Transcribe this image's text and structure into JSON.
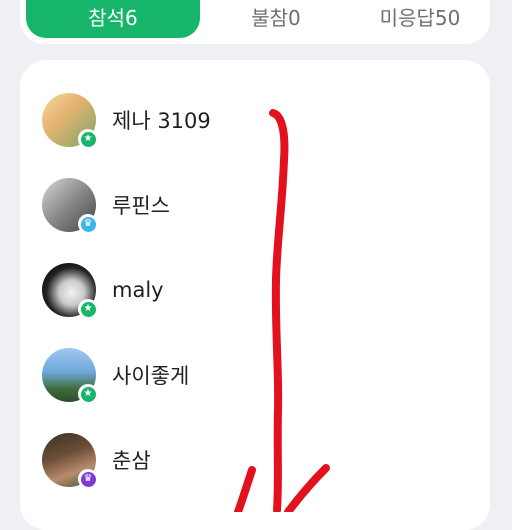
{
  "tabs": [
    {
      "label": "참석6",
      "active": true
    },
    {
      "label": "불참0",
      "active": false
    },
    {
      "label": "미응답50",
      "active": false
    }
  ],
  "members": [
    {
      "name": "제나 3109",
      "badge_icon": "star-icon",
      "badge_color": "#17b56a",
      "avatar": "flower-doll-photo"
    },
    {
      "name": "루핀스",
      "badge_icon": "crown-icon",
      "badge_color": "#3bb6e8",
      "avatar": "street-photo"
    },
    {
      "name": "maly",
      "badge_icon": "star-icon",
      "badge_color": "#17b56a",
      "avatar": "bw-portrait-photo"
    },
    {
      "name": "사이좋게",
      "badge_icon": "star-icon",
      "badge_color": "#17b56a",
      "avatar": "tree-sky-photo"
    },
    {
      "name": "춘삼",
      "badge_icon": "crown-icon",
      "badge_color": "#7d3bd6",
      "avatar": "portrait-photo"
    }
  ],
  "colors": {
    "accent": "#17b56a",
    "annotation": "#e3101e",
    "background": "#eef0f3"
  }
}
